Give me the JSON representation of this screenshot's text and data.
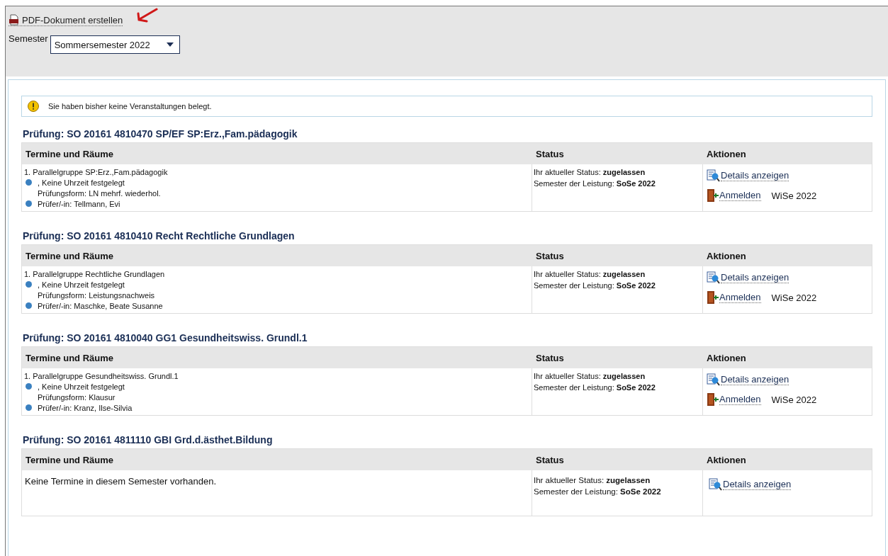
{
  "pdf_link": "PDF-Dokument erstellen",
  "semester": {
    "label": "Semester",
    "value": "Sommersemester 2022"
  },
  "info": "Sie haben bisher keine Veranstaltungen belegt.",
  "exams": [
    {
      "title": "Prüfung: SO 20161 4810470 SP/EF SP:Erz.,Fam.pädagogik",
      "columns": [
        "Termine und Räume",
        "Status",
        "Aktionen"
      ],
      "lines": [
        {
          "kind": "plain",
          "text": "1. Parallelgruppe SP:Erz.,Fam.pädagogik"
        },
        {
          "kind": "bullet",
          "text": ", Keine Uhrzeit festgelegt"
        },
        {
          "kind": "indent",
          "text": "Prüfungsform: LN mehrf. wiederhol."
        },
        {
          "kind": "bullet",
          "text": "Prüfer/-in: Tellmann, Evi"
        }
      ],
      "status": [
        "Ihr aktueller Status: **zugelassen**",
        "Semester der Leistung:  **SoSe 2022**"
      ],
      "actions": [
        {
          "kind": "details",
          "label": "Details anzeigen"
        },
        {
          "kind": "register",
          "label": "Anmelden",
          "note": "WiSe 2022"
        }
      ]
    },
    {
      "title": "Prüfung: SO 20161 4810410 Recht Rechtliche Grundlagen",
      "columns": [
        "Termine und Räume",
        "Status",
        "Aktionen"
      ],
      "lines": [
        {
          "kind": "plain",
          "text": "1. Parallelgruppe Rechtliche Grundlagen"
        },
        {
          "kind": "bullet",
          "text": ", Keine Uhrzeit festgelegt"
        },
        {
          "kind": "indent",
          "text": "Prüfungsform: Leistungsnachweis"
        },
        {
          "kind": "bullet",
          "text": "Prüfer/-in: Maschke, Beate Susanne"
        }
      ],
      "status": [
        "Ihr aktueller Status: **zugelassen**",
        "Semester der Leistung:  **SoSe 2022**"
      ],
      "actions": [
        {
          "kind": "details",
          "label": "Details anzeigen"
        },
        {
          "kind": "register",
          "label": "Anmelden",
          "note": "WiSe 2022"
        }
      ]
    },
    {
      "title": "Prüfung: SO 20161 4810040 GG1 Gesundheitswiss. Grundl.1",
      "columns": [
        "Termine und Räume",
        "Status",
        "Aktionen"
      ],
      "lines": [
        {
          "kind": "plain",
          "text": "1. Parallelgruppe Gesundheitswiss. Grundl.1"
        },
        {
          "kind": "bullet",
          "text": ", Keine Uhrzeit festgelegt"
        },
        {
          "kind": "indent",
          "text": "Prüfungsform: Klausur"
        },
        {
          "kind": "bullet",
          "text": "Prüfer/-in: Kranz, Ilse-Silvia"
        }
      ],
      "status": [
        "Ihr aktueller Status: **zugelassen**",
        "Semester der Leistung:  **SoSe 2022**"
      ],
      "actions": [
        {
          "kind": "details",
          "label": "Details anzeigen"
        },
        {
          "kind": "register",
          "label": "Anmelden",
          "note": "WiSe 2022"
        }
      ]
    },
    {
      "title": "Prüfung: SO 20161 4811110 GBI Grd.d.ästhet.Bildung",
      "columns": [
        "Termine und Räume",
        "Status",
        "Aktionen"
      ],
      "empty": "Keine Termine in diesem Semester vorhanden.",
      "status": [
        "Ihr aktueller Status: **zugelassen**",
        "Semester der Leistung:  **SoSe 2022**"
      ],
      "actions": [
        {
          "kind": "details",
          "label": "Details anzeigen"
        }
      ]
    }
  ]
}
